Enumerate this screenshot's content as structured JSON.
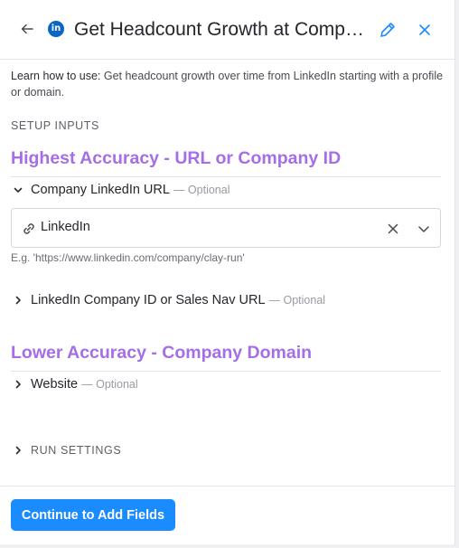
{
  "header": {
    "title": "Get Headcount Growth at Company LinkedIn",
    "logo_text": "in",
    "icons": {
      "back": "arrow-left-icon",
      "logo": "linkedin-logo-icon",
      "edit": "pencil-icon",
      "close": "close-icon"
    }
  },
  "description": {
    "prefix": "Learn how to use:",
    "text": "Get headcount growth over time from LinkedIn starting with a profile or domain."
  },
  "setup": {
    "label": "SETUP INPUTS",
    "groups": [
      {
        "heading": "Highest Accuracy - URL or Company ID",
        "fields": [
          {
            "label": "Company LinkedIn URL",
            "optional": "— Optional",
            "expanded": true,
            "value": "LinkedIn",
            "hint": "E.g. 'https://www.linkedin.com/company/clay-run'"
          },
          {
            "label": "LinkedIn Company ID or Sales Nav URL",
            "optional": "— Optional",
            "expanded": false
          }
        ]
      },
      {
        "heading": "Lower Accuracy - Company Domain",
        "fields": [
          {
            "label": "Website",
            "optional": "— Optional",
            "expanded": false
          }
        ]
      }
    ]
  },
  "run_settings": {
    "label": "RUN SETTINGS",
    "expanded": false
  },
  "footer": {
    "primary_label": "Continue to Add Fields"
  },
  "colors": {
    "accent": "#1a8cff",
    "group_heading": "#a66ee6",
    "linkedin": "#0a66c2"
  }
}
